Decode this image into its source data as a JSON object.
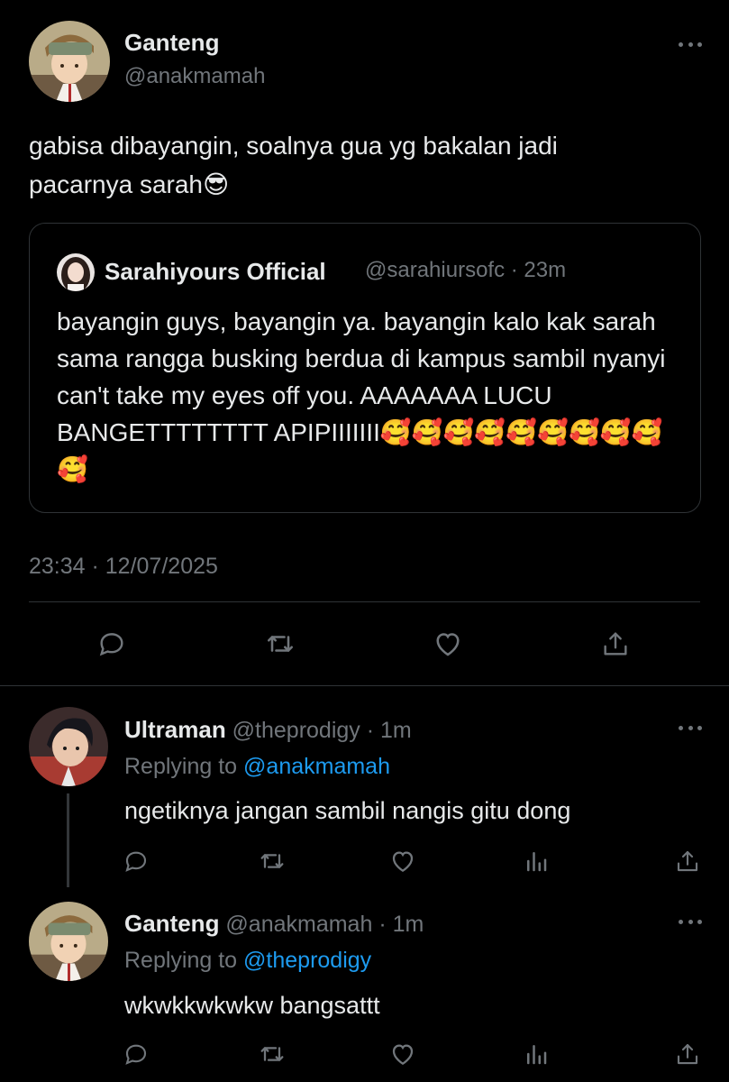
{
  "main_tweet": {
    "author_name": "Ganteng",
    "author_handle": "@anakmamah",
    "text": "gabisa dibayangin, soalnya gua yg bakalan jadi pacarnya sarah😎",
    "timestamp": "23:34 · 12/07/2025",
    "quoted": {
      "author_name": "Sarahiyours Official",
      "author_handle": "@sarahiursofc",
      "time": "· 23m",
      "text": "bayangin guys, bayangin ya. bayangin kalo kak sarah sama rangga busking berdua di kampus sambil nyanyi can't take my eyes off you. AAAAAAA LUCU BANGETTTTTTTT APIPIIIIIII🥰🥰🥰🥰🥰🥰🥰🥰🥰🥰"
    },
    "actions": [
      "reply-icon",
      "retweet-icon",
      "like-icon",
      "share-icon"
    ]
  },
  "replies": [
    {
      "author_name": "Ultraman",
      "author_handle": "@theprodigy",
      "time": "· 1m",
      "replying_label": "Replying to",
      "replying_to": "@anakmamah",
      "text": "ngetiknya jangan sambil nangis gitu dong",
      "actions": [
        "reply-icon",
        "retweet-icon",
        "like-icon",
        "analytics-icon",
        "share-icon"
      ]
    },
    {
      "author_name": "Ganteng",
      "author_handle": "@anakmamah",
      "time": "· 1m",
      "replying_label": "Replying to",
      "replying_to": "@theprodigy",
      "text": "wkwkkwkwkw bangsattt",
      "actions": [
        "reply-icon",
        "retweet-icon",
        "like-icon",
        "analytics-icon",
        "share-icon"
      ]
    }
  ],
  "colors": {
    "background": "#000000",
    "text": "#e7e9ea",
    "muted": "#71767b",
    "link": "#1d9bf0",
    "border": "#2f3336"
  }
}
